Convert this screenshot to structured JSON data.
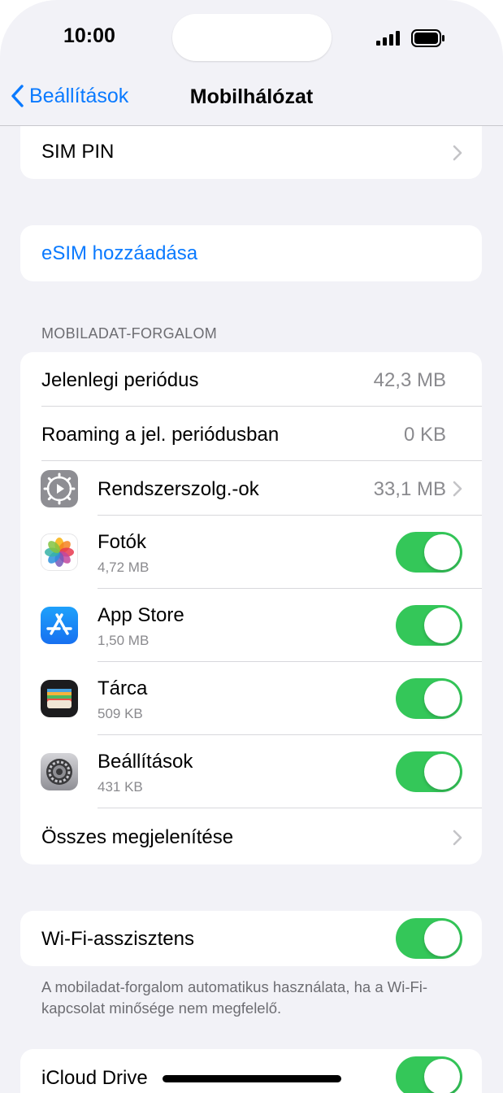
{
  "status_bar": {
    "time": "10:00"
  },
  "nav": {
    "back_label": "Beállítások",
    "title": "Mobilhálózat"
  },
  "sim_pin": {
    "label": "SIM PIN"
  },
  "esim": {
    "label": "eSIM hozzáadása"
  },
  "data_section": {
    "header": "MOBILADAT-FORGALOM",
    "current_period": {
      "label": "Jelenlegi periódus",
      "value": "42,3 MB"
    },
    "roaming": {
      "label": "Roaming a jel. periódusban",
      "value": "0 KB"
    },
    "system_services": {
      "label": "Rendszerszolg.-ok",
      "value": "33,1 MB"
    },
    "apps": [
      {
        "name": "Fotók",
        "size": "4,72 MB",
        "icon": "photos-icon",
        "enabled": true
      },
      {
        "name": "App Store",
        "size": "1,50 MB",
        "icon": "app-store-icon",
        "enabled": true
      },
      {
        "name": "Tárca",
        "size": "509 KB",
        "icon": "wallet-icon",
        "enabled": true
      },
      {
        "name": "Beállítások",
        "size": "431 KB",
        "icon": "settings-icon",
        "enabled": true
      }
    ],
    "show_all": {
      "label": "Összes megjelenítése"
    }
  },
  "wifi_assist": {
    "label": "Wi-Fi-asszisztens",
    "enabled": true,
    "footer": "A mobiladat-forgalom automatikus használata, ha a Wi-Fi-kapcsolat minősége nem megfelelő."
  },
  "icloud": {
    "label": "iCloud Drive",
    "enabled": true
  },
  "colors": {
    "accent": "#0a7aff",
    "toggle_on": "#34c759",
    "background": "#f2f2f7"
  }
}
